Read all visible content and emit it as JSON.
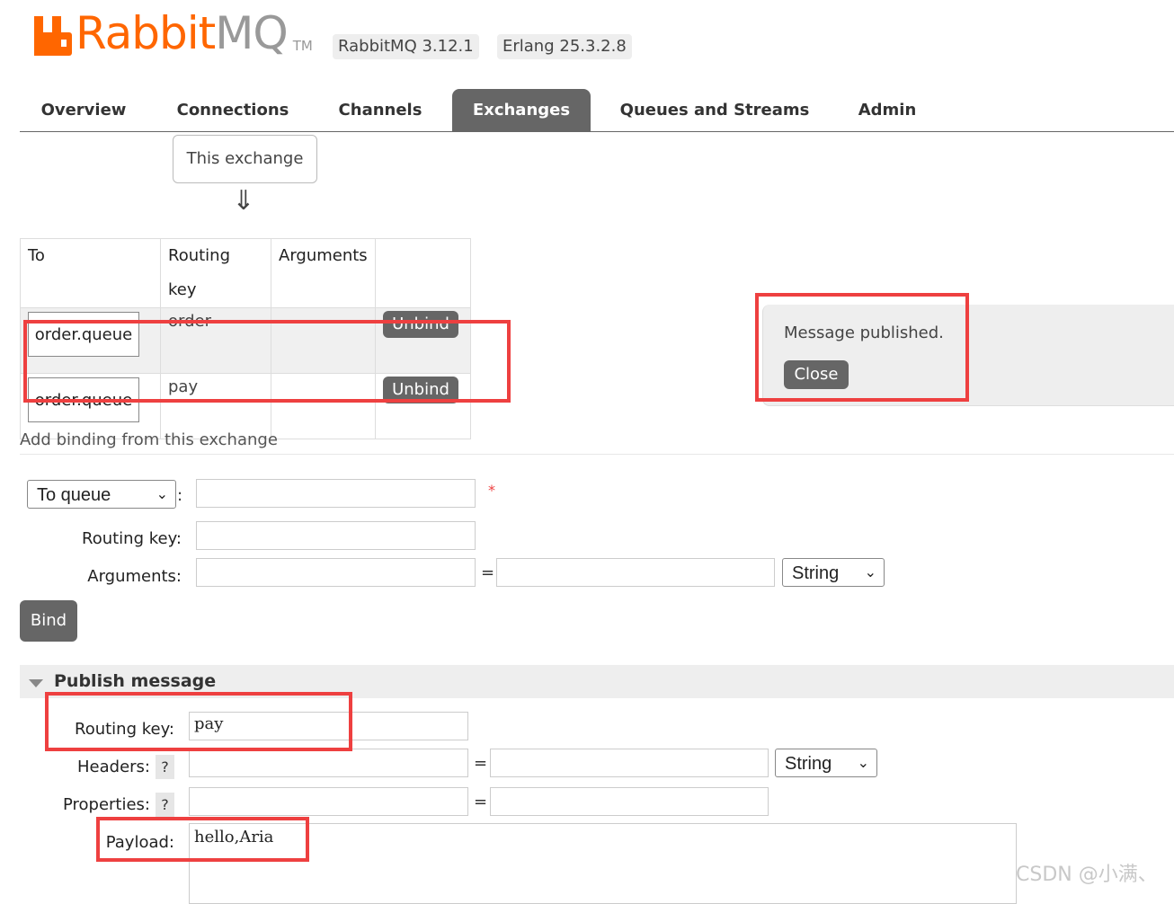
{
  "header": {
    "logo_rabbit": "Rabbit",
    "logo_mq": "MQ",
    "logo_tm": "TM",
    "rabbitmq_version": "RabbitMQ 3.12.1",
    "erlang_version": "Erlang 25.3.2.8"
  },
  "tabs": [
    {
      "label": "Overview",
      "active": false
    },
    {
      "label": "Connections",
      "active": false
    },
    {
      "label": "Channels",
      "active": false
    },
    {
      "label": "Exchanges",
      "active": true
    },
    {
      "label": "Queues and Streams",
      "active": false
    },
    {
      "label": "Admin",
      "active": false
    }
  ],
  "bindings": {
    "source_label": "This exchange",
    "arrow": "⇓",
    "columns": [
      "To",
      "Routing key",
      "Arguments",
      ""
    ],
    "rows": [
      {
        "to": "order.queue",
        "routing_key": "order",
        "arguments": "",
        "action": "Unbind"
      },
      {
        "to": "order.queue",
        "routing_key": "pay",
        "arguments": "",
        "action": "Unbind"
      }
    ]
  },
  "notification": {
    "message": "Message published.",
    "close_label": "Close"
  },
  "add_binding": {
    "title": "Add binding from this exchange",
    "destination_type": "To queue",
    "colon": ":",
    "required_mark": "*",
    "routing_key_label": "Routing key:",
    "arguments_label": "Arguments:",
    "equals": "=",
    "arg_type": "String",
    "bind_label": "Bind"
  },
  "publish": {
    "title": "Publish message",
    "routing_key_label": "Routing key:",
    "routing_key_value": "pay",
    "headers_label": "Headers:",
    "properties_label": "Properties:",
    "help": "?",
    "equals": "=",
    "header_type": "String",
    "payload_label": "Payload:",
    "payload_value": "hello,Aria"
  },
  "watermark": "CSDN @小满、",
  "colors": {
    "brand_orange": "#ff6600",
    "tab_active": "#666666",
    "annotation_red": "#ee4040"
  }
}
